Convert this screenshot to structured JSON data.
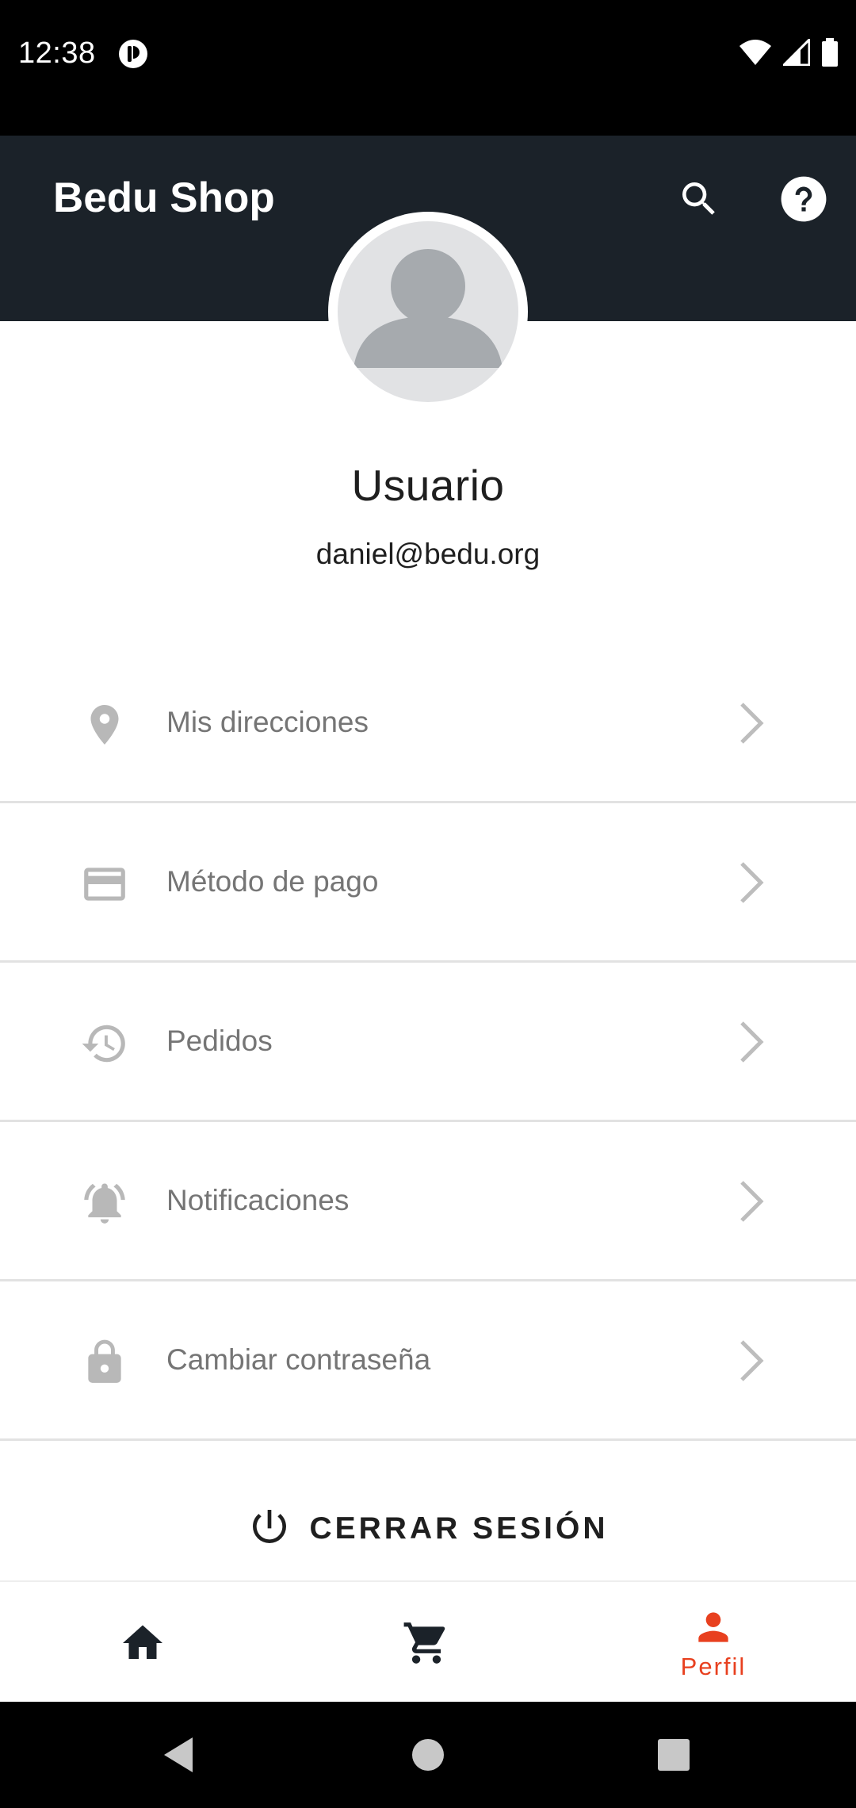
{
  "status_bar": {
    "time": "12:38",
    "icons": [
      "app-notification-icon",
      "wifi-icon",
      "cellular-icon",
      "battery-icon"
    ]
  },
  "app_bar": {
    "title": "Bedu Shop",
    "actions": [
      "search-icon",
      "help-icon"
    ],
    "background": "#1b2229"
  },
  "profile": {
    "name": "Usuario",
    "email": "daniel@bedu.org"
  },
  "menu": {
    "items": [
      {
        "label": "Mis direcciones",
        "icon": "location-pin-icon"
      },
      {
        "label": "Método de pago",
        "icon": "credit-card-icon"
      },
      {
        "label": "Pedidos",
        "icon": "history-icon"
      },
      {
        "label": "Notificaciones",
        "icon": "bell-icon"
      },
      {
        "label": "Cambiar contraseña",
        "icon": "lock-icon"
      }
    ]
  },
  "logout": {
    "label": "CERRAR SESIÓN",
    "icon": "power-icon"
  },
  "bottom_nav": {
    "items": [
      {
        "icon": "home-icon",
        "label": ""
      },
      {
        "icon": "cart-icon",
        "label": ""
      },
      {
        "icon": "person-icon",
        "label": "Perfil",
        "active": true
      }
    ],
    "active_color": "#e8401f",
    "inactive_color": "#1b2229"
  },
  "system_nav": {
    "icons": [
      "back-icon",
      "home-circle-icon",
      "recents-icon"
    ]
  }
}
